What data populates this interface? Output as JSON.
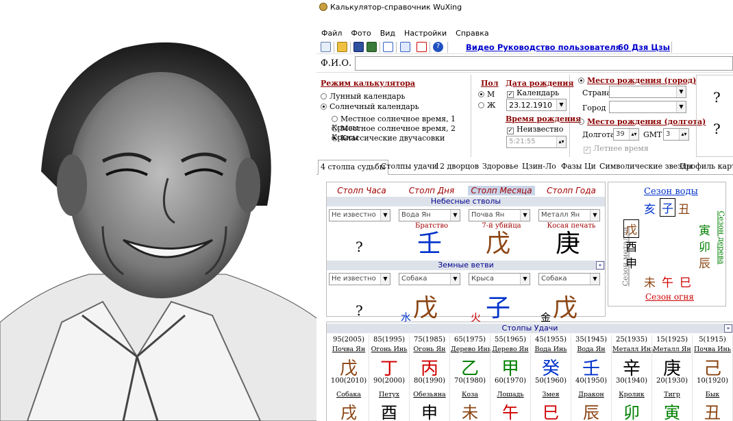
{
  "window": {
    "title": "Калькулятор-справочник WuXing"
  },
  "menu": [
    "Файл",
    "Фото",
    "Вид",
    "Настройки",
    "Справка"
  ],
  "toolbar": {
    "video_link": "Видео Руководство пользователя",
    "dates_link": "60 Дзя Цзы"
  },
  "fio": {
    "label": "Ф.И.О.",
    "value": ""
  },
  "mode": {
    "title": "Режим калькулятора",
    "lunar": "Лунный календарь",
    "solar": "Солнечный календарь",
    "opt1": "Местное солнечное время, 1 Крысы",
    "opt2": "Местное солнечное время, 2 Крысы",
    "opt3": "Классические двучасовки"
  },
  "gender": {
    "title": "Пол",
    "m": "М",
    "f": "Ж"
  },
  "birth": {
    "date_title": "Дата рождения",
    "calendar": "Календарь",
    "date": "23.12.1910",
    "time_title": "Время рождения",
    "unknown": "Неизвестно",
    "time": "5:21:55"
  },
  "place": {
    "city_title": "Место рождения (город)",
    "country": "Страна",
    "city": "Город",
    "lon_title": "Место рождения (долгота)",
    "lon_label": "Долгота",
    "lon": "39",
    "gmt_label": "GMT",
    "gmt": "3",
    "summer": "Летнее время",
    "q1": "?",
    "q2": "?"
  },
  "tabs": [
    "4 столпа судьбы",
    "Столпы удачи",
    "12 дворцов",
    "Здоровье",
    "Цзин-Ло",
    "Фазы Ци",
    "Символические звезды",
    "Профиль карты"
  ],
  "pillars": {
    "headers": [
      "Столп Часа",
      "Столп Дня",
      "Столп Месяца",
      "Столп Года"
    ],
    "stems_title": "Небесные стволы",
    "branches_title": "Земные ветви",
    "stem_selects": [
      "Не известно",
      "Вода Ян",
      "Почва Ян",
      "Металл Ян"
    ],
    "stem_notes": [
      "",
      "Братство",
      "7-й убийца",
      "Косая печать"
    ],
    "stem_glyphs": [
      "?",
      "壬",
      "戊",
      "庚"
    ],
    "branch_selects": [
      "Не известно",
      "Собака",
      "Крыса",
      "Собака"
    ],
    "branch_small": [
      "",
      "水",
      "火",
      "金"
    ],
    "branch_glyphs": [
      "?",
      "戊",
      "子",
      "戊"
    ]
  },
  "season": {
    "water": "Сезон воды",
    "fire": "Сезон огня",
    "metal": "Сезон металла",
    "wood": "Сезон дерева",
    "top": [
      "亥",
      "子",
      "丑"
    ],
    "left": [
      "戊",
      "酉",
      "申"
    ],
    "right": [
      "寅",
      "卯",
      "辰"
    ],
    "bottom": [
      "未",
      "午",
      "巳"
    ]
  },
  "luck": {
    "title": "Столпы Удачи",
    "years1": [
      "95(2005)",
      "85(1995)",
      "75(1985)",
      "65(1975)",
      "55(1965)",
      "45(1955)",
      "35(1945)",
      "25(1935)",
      "15(1925)",
      "5(1915)"
    ],
    "names1": [
      "Почва Ян",
      "Огонь Инь",
      "Огонь Ян",
      "Дерево Инь",
      "Дерево Ян",
      "Вода Инь",
      "Вода Ян",
      "Металл Инь",
      "Металл Ян",
      "Почва Инь"
    ],
    "glyphs1": [
      "戊",
      "丁",
      "丙",
      "乙",
      "甲",
      "癸",
      "壬",
      "辛",
      "庚",
      "己"
    ],
    "years2": [
      "100(2010)",
      "90(2000)",
      "80(1990)",
      "70(1980)",
      "60(1970)",
      "50(1960)",
      "40(1950)",
      "30(1940)",
      "20(1930)",
      "10(1920)"
    ],
    "names2": [
      "Собака",
      "Петух",
      "Обезьяна",
      "Коза",
      "Лошадь",
      "Змея",
      "Дракон",
      "Кролик",
      "Тигр",
      "Бык"
    ],
    "glyphs2": [
      "戌",
      "酉",
      "申",
      "未",
      "午",
      "巳",
      "辰",
      "卯",
      "寅",
      "丑"
    ]
  },
  "colors": {
    "earth": "#8b4513",
    "fire": "#d00000",
    "wood": "#008000",
    "water": "#0033cc",
    "metal": "#000000"
  }
}
